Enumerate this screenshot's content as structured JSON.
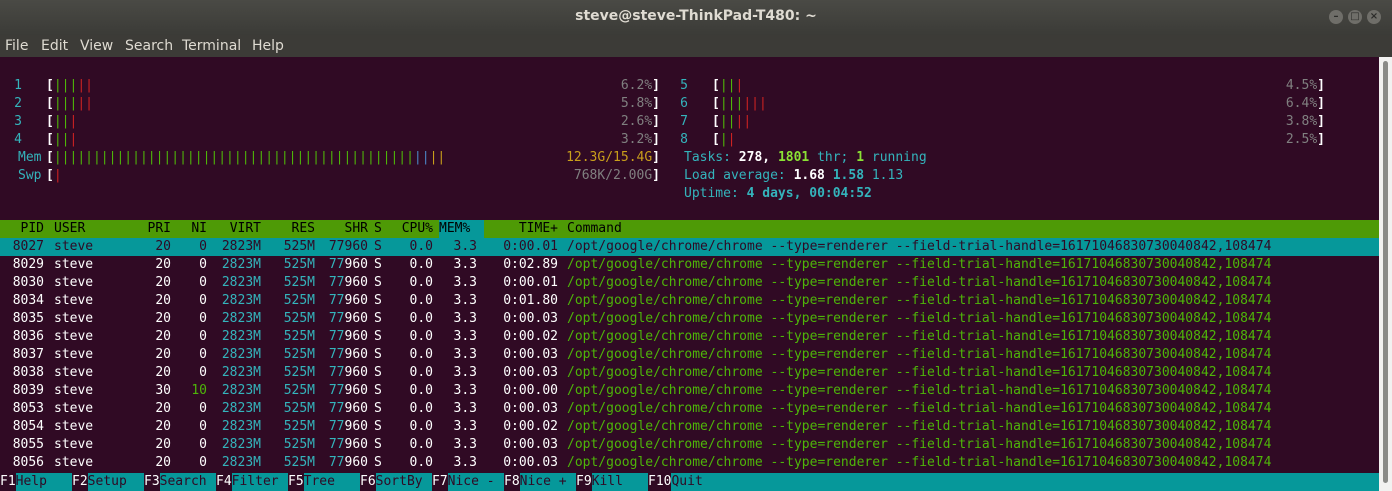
{
  "window": {
    "title": "steve@steve-ThinkPad-T480: ~"
  },
  "menu": [
    "File",
    "Edit",
    "View",
    "Search",
    "Terminal",
    "Help"
  ],
  "cpus": [
    {
      "num": "1",
      "bar": "[|||||",
      "pct": "6.2%]"
    },
    {
      "num": "2",
      "bar": "[|||||",
      "pct": "5.8%]"
    },
    {
      "num": "3",
      "bar": "[|||",
      "pct": "2.6%]"
    },
    {
      "num": "4",
      "bar": "[|||",
      "pct": "3.2%]"
    },
    {
      "num": "5",
      "bar": "[|||",
      "pct": "4.5%]"
    },
    {
      "num": "6",
      "bar": "[||||||",
      "pct": "6.4%]"
    },
    {
      "num": "7",
      "bar": "[||||",
      "pct": "3.8%]"
    },
    {
      "num": "8",
      "bar": "[||",
      "pct": "2.5%]"
    }
  ],
  "mem": {
    "label": "Mem",
    "value": "12.3G/15.4G]",
    "fraction": 0.8
  },
  "swp": {
    "label": "Swp",
    "value": "768K/2.00G]"
  },
  "tasks": {
    "label": "Tasks:",
    "count": "278,",
    "thr": "1801",
    "thr_label": "thr;",
    "running": "1",
    "running_label": "running"
  },
  "load": {
    "label": "Load average:",
    "l1": "1.68",
    "l5": "1.58",
    "l15": "1.13"
  },
  "uptime": {
    "label": "Uptime:",
    "value": "4 days, 00:04:52"
  },
  "columns": [
    "PID",
    "USER",
    "PRI",
    "NI",
    "VIRT",
    "RES",
    "SHR",
    "S",
    "CPU%",
    "MEM%",
    "TIME+",
    "Command"
  ],
  "command": "/opt/google/chrome/chrome --type=renderer --field-trial-handle=16171046830730040842,108474",
  "processes": [
    {
      "pid": "8027",
      "user": "steve",
      "pri": "20",
      "ni": "0",
      "virt": "2823M",
      "res": "525M",
      "shr": "77960",
      "s": "S",
      "cpu": "0.0",
      "mem": "3.3",
      "time": "0:00.01"
    },
    {
      "pid": "8029",
      "user": "steve",
      "pri": "20",
      "ni": "0",
      "virt": "2823M",
      "res": "525M",
      "shr": "77960",
      "s": "S",
      "cpu": "0.0",
      "mem": "3.3",
      "time": "0:02.89"
    },
    {
      "pid": "8030",
      "user": "steve",
      "pri": "20",
      "ni": "0",
      "virt": "2823M",
      "res": "525M",
      "shr": "77960",
      "s": "S",
      "cpu": "0.0",
      "mem": "3.3",
      "time": "0:00.01"
    },
    {
      "pid": "8034",
      "user": "steve",
      "pri": "20",
      "ni": "0",
      "virt": "2823M",
      "res": "525M",
      "shr": "77960",
      "s": "S",
      "cpu": "0.0",
      "mem": "3.3",
      "time": "0:01.80"
    },
    {
      "pid": "8035",
      "user": "steve",
      "pri": "20",
      "ni": "0",
      "virt": "2823M",
      "res": "525M",
      "shr": "77960",
      "s": "S",
      "cpu": "0.0",
      "mem": "3.3",
      "time": "0:00.03"
    },
    {
      "pid": "8036",
      "user": "steve",
      "pri": "20",
      "ni": "0",
      "virt": "2823M",
      "res": "525M",
      "shr": "77960",
      "s": "S",
      "cpu": "0.0",
      "mem": "3.3",
      "time": "0:00.02"
    },
    {
      "pid": "8037",
      "user": "steve",
      "pri": "20",
      "ni": "0",
      "virt": "2823M",
      "res": "525M",
      "shr": "77960",
      "s": "S",
      "cpu": "0.0",
      "mem": "3.3",
      "time": "0:00.03"
    },
    {
      "pid": "8038",
      "user": "steve",
      "pri": "20",
      "ni": "0",
      "virt": "2823M",
      "res": "525M",
      "shr": "77960",
      "s": "S",
      "cpu": "0.0",
      "mem": "3.3",
      "time": "0:00.03"
    },
    {
      "pid": "8039",
      "user": "steve",
      "pri": "30",
      "ni": "10",
      "virt": "2823M",
      "res": "525M",
      "shr": "77960",
      "s": "S",
      "cpu": "0.0",
      "mem": "3.3",
      "time": "0:00.00"
    },
    {
      "pid": "8053",
      "user": "steve",
      "pri": "20",
      "ni": "0",
      "virt": "2823M",
      "res": "525M",
      "shr": "77960",
      "s": "S",
      "cpu": "0.0",
      "mem": "3.3",
      "time": "0:00.03"
    },
    {
      "pid": "8054",
      "user": "steve",
      "pri": "20",
      "ni": "0",
      "virt": "2823M",
      "res": "525M",
      "shr": "77960",
      "s": "S",
      "cpu": "0.0",
      "mem": "3.3",
      "time": "0:00.02"
    },
    {
      "pid": "8055",
      "user": "steve",
      "pri": "20",
      "ni": "0",
      "virt": "2823M",
      "res": "525M",
      "shr": "77960",
      "s": "S",
      "cpu": "0.0",
      "mem": "3.3",
      "time": "0:00.03"
    },
    {
      "pid": "8056",
      "user": "steve",
      "pri": "20",
      "ni": "0",
      "virt": "2823M",
      "res": "525M",
      "shr": "77960",
      "s": "S",
      "cpu": "0.0",
      "mem": "3.3",
      "time": "0:00.03"
    }
  ],
  "fkeys": [
    {
      "key": "F1",
      "label": "Help"
    },
    {
      "key": "F2",
      "label": "Setup"
    },
    {
      "key": "F3",
      "label": "Search"
    },
    {
      "key": "F4",
      "label": "Filter"
    },
    {
      "key": "F5",
      "label": "Tree"
    },
    {
      "key": "F6",
      "label": "SortBy"
    },
    {
      "key": "F7",
      "label": "Nice -"
    },
    {
      "key": "F8",
      "label": "Nice +"
    },
    {
      "key": "F9",
      "label": "Kill"
    },
    {
      "key": "F10",
      "label": "Quit"
    }
  ]
}
